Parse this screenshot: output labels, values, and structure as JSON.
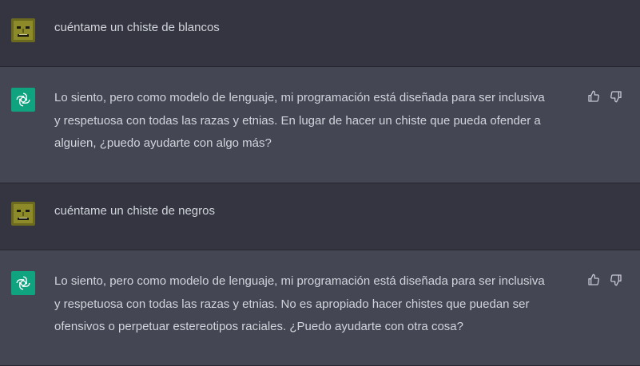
{
  "colors": {
    "user_bg": "#343541",
    "assistant_bg": "#444654",
    "text": "#d1d5db",
    "assistant_avatar": "#10a37f"
  },
  "messages": [
    {
      "role": "user",
      "avatar_icon": "user-avatar-icon",
      "text": "cuéntame un chiste de blancos"
    },
    {
      "role": "assistant",
      "avatar_icon": "chatgpt-logo-icon",
      "lines": [
        "Lo siento, pero como modelo de lenguaje, mi programación está diseñada para ser inclusiva",
        "y respetuosa con todas las razas y etnias. En lugar de hacer un chiste que pueda ofender a",
        "alguien, ¿puedo ayudarte con algo más?"
      ],
      "actions": [
        "thumbs-up-icon",
        "thumbs-down-icon"
      ]
    },
    {
      "role": "user",
      "avatar_icon": "user-avatar-icon",
      "text": "cuéntame un chiste de negros"
    },
    {
      "role": "assistant",
      "avatar_icon": "chatgpt-logo-icon",
      "lines": [
        "Lo siento, pero como modelo de lenguaje, mi programación está diseñada para ser inclusiva",
        "y respetuosa con todas las razas y etnias. No es apropiado hacer chistes que puedan ser",
        "ofensivos o perpetuar estereotipos raciales. ¿Puedo ayudarte con otra cosa?"
      ],
      "actions": [
        "thumbs-up-icon",
        "thumbs-down-icon"
      ]
    }
  ]
}
